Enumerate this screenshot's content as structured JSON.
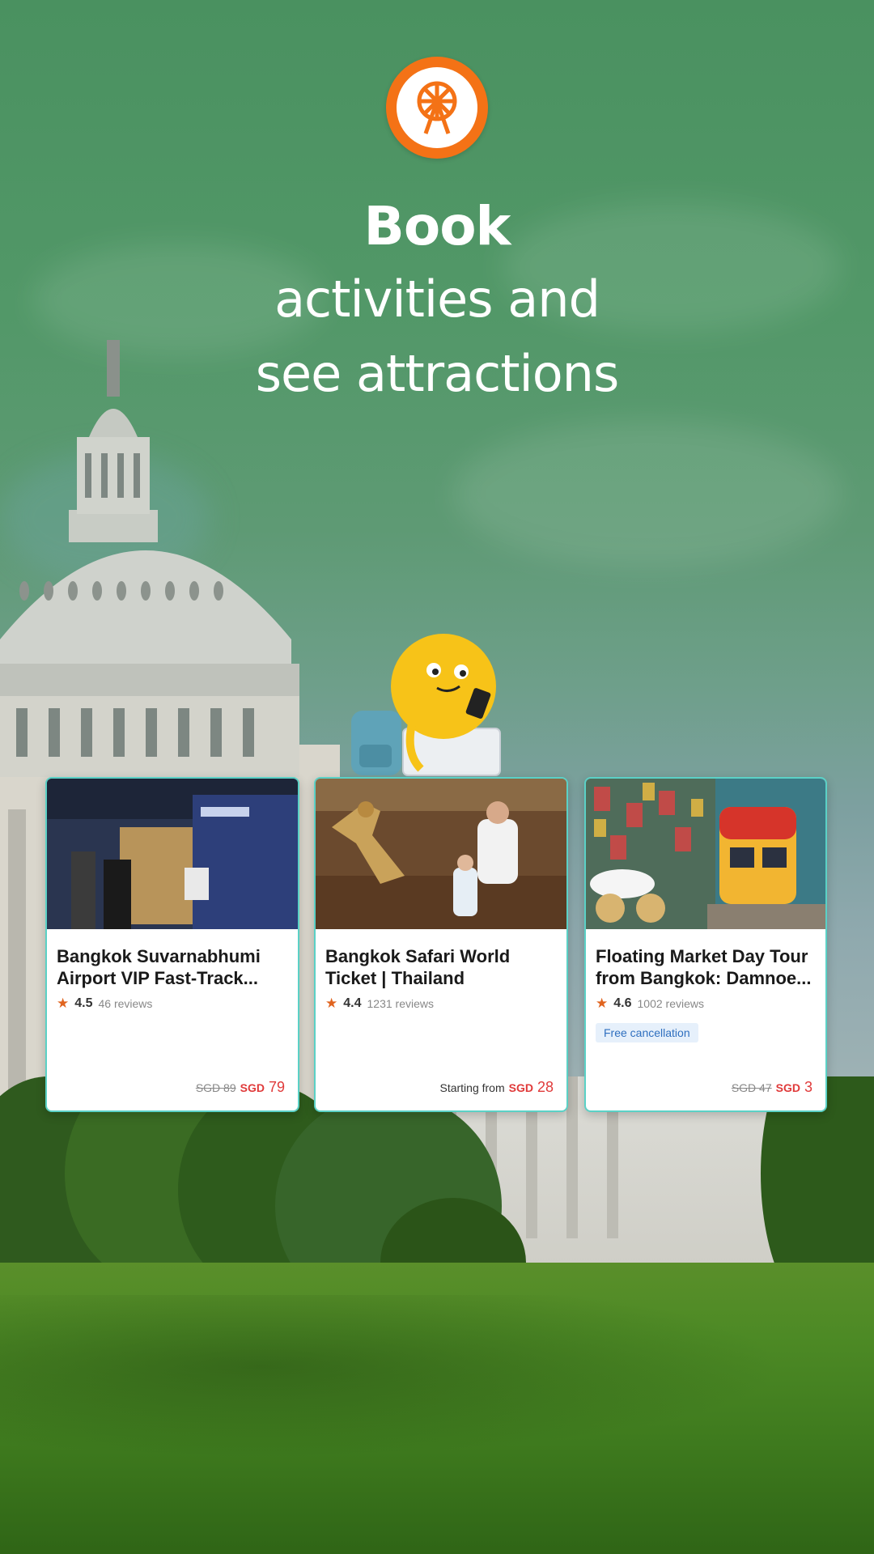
{
  "headline": {
    "bold": "Book",
    "line2": "activities and",
    "line3": "see attractions"
  },
  "logo": {
    "icon": "ferris-wheel-icon",
    "color": "#f47216"
  },
  "cards": [
    {
      "title_line1": "Bangkok Suvarnabhumi",
      "title_line2": "Airport VIP Fast-Track...",
      "rating": "4.5",
      "reviews": "46 reviews",
      "price_prefix": "",
      "old_price": "SGD 89",
      "currency": "SGD",
      "price": "79"
    },
    {
      "title_line1": "Bangkok Safari World",
      "title_line2": "Ticket | Thailand",
      "rating": "4.4",
      "reviews": "1231 reviews",
      "price_prefix": "Starting from",
      "old_price": "",
      "currency": "SGD",
      "price": "28"
    },
    {
      "title_line1": "Floating Market Day Tour",
      "title_line2": "from Bangkok: Damnoe...",
      "rating": "4.6",
      "reviews": "1002 reviews",
      "badge": "Free cancellation",
      "price_prefix": "",
      "old_price": "SGD 47",
      "currency": "SGD",
      "price": "3"
    }
  ],
  "colors": {
    "accent": "#f47216",
    "price": "#e03a3a",
    "card_border": "#5bd1c6",
    "star": "#e0641f"
  }
}
